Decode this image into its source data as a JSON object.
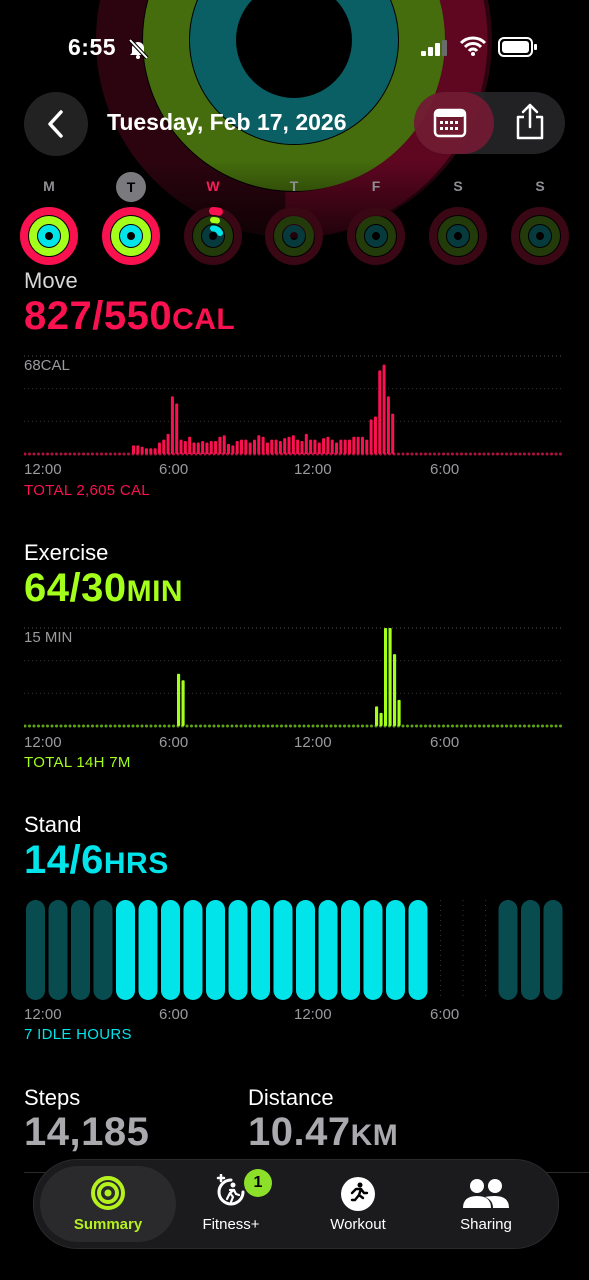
{
  "status_bar": {
    "time": "6:55"
  },
  "header": {
    "date": "Tuesday, Feb 17, 2026"
  },
  "week": {
    "days": [
      {
        "letter": "M"
      },
      {
        "letter": "T"
      },
      {
        "letter": "W"
      },
      {
        "letter": "T"
      },
      {
        "letter": "F"
      },
      {
        "letter": "S"
      },
      {
        "letter": "S"
      }
    ],
    "today_index": 1
  },
  "move": {
    "label": "Move",
    "value": "827/550",
    "unit": "CAL",
    "scale_label": "68CAL",
    "total": "TOTAL 2,605 CAL",
    "color": "#fa1150"
  },
  "exercise": {
    "label": "Exercise",
    "value": "64/30",
    "unit": "MIN",
    "scale_label": "15 MIN",
    "total": "TOTAL 14H 7M",
    "color": "#a4ff1a"
  },
  "stand": {
    "label": "Stand",
    "value": "14/6",
    "unit": "HRS",
    "total": "7 IDLE HOURS",
    "color": "#00e4ea"
  },
  "axis_ticks": [
    "12:00",
    "6:00",
    "12:00",
    "6:00"
  ],
  "steps": {
    "label": "Steps",
    "value": "14,185"
  },
  "distance": {
    "label": "Distance",
    "value": "10.47",
    "unit": "KM"
  },
  "tabs": [
    {
      "label": "Summary",
      "icon": "summary-rings-icon"
    },
    {
      "label": "Fitness+",
      "icon": "fitness-plus-icon",
      "badge": "1"
    },
    {
      "label": "Workout",
      "icon": "workout-runner-icon"
    },
    {
      "label": "Sharing",
      "icon": "sharing-people-icon"
    }
  ],
  "colors": {
    "move": "#fa1150",
    "exercise": "#a4ff1a",
    "stand": "#00e4ea",
    "accent_tab": "#b5f11f"
  },
  "chart_data": [
    {
      "type": "bar",
      "title": "Move",
      "ylabel": "CAL",
      "ylim": [
        0,
        68
      ],
      "values": [
        0,
        0,
        0,
        0,
        0,
        0,
        0,
        0,
        0,
        0,
        0,
        0,
        0,
        0,
        0,
        0,
        0,
        0,
        0,
        0,
        0,
        0,
        0,
        0,
        0,
        6,
        6,
        5,
        4,
        4,
        4,
        8,
        10,
        14,
        40,
        35,
        10,
        9,
        12,
        8,
        8,
        9,
        8,
        9,
        9,
        12,
        13,
        7,
        6,
        9,
        10,
        10,
        8,
        10,
        13,
        12,
        8,
        10,
        10,
        9,
        11,
        12,
        13,
        10,
        9,
        14,
        10,
        10,
        8,
        11,
        12,
        10,
        8,
        10,
        10,
        10,
        12,
        12,
        12,
        10,
        24,
        26,
        58,
        62,
        40,
        28,
        0,
        0,
        0,
        0,
        0,
        0,
        0,
        0,
        0,
        0,
        0,
        0,
        0,
        0,
        0,
        0,
        0,
        0,
        0,
        0,
        0,
        0,
        0,
        0,
        0,
        0,
        0,
        0,
        0,
        0,
        0,
        0,
        0,
        0,
        0,
        0,
        0,
        0,
        0
      ]
    },
    {
      "type": "bar",
      "title": "Exercise",
      "ylabel": "MIN",
      "ylim": [
        0,
        15
      ],
      "values": [
        0,
        0,
        0,
        0,
        0,
        0,
        0,
        0,
        0,
        0,
        0,
        0,
        0,
        0,
        0,
        0,
        0,
        0,
        0,
        0,
        0,
        0,
        0,
        0,
        0,
        0,
        0,
        0,
        0,
        0,
        0,
        0,
        0,
        0,
        8,
        7,
        0,
        0,
        0,
        0,
        0,
        0,
        0,
        0,
        0,
        0,
        0,
        0,
        0,
        0,
        0,
        0,
        0,
        0,
        0,
        0,
        0,
        0,
        0,
        0,
        0,
        0,
        0,
        0,
        0,
        0,
        0,
        0,
        0,
        0,
        0,
        0,
        0,
        0,
        0,
        0,
        0,
        0,
        3,
        2,
        15,
        15,
        11,
        4,
        0,
        0,
        0,
        0,
        0,
        0,
        0,
        0,
        0,
        0,
        0,
        0,
        0,
        0,
        0,
        0,
        0,
        0,
        0,
        0,
        0,
        0,
        0,
        0,
        0,
        0,
        0,
        0,
        0,
        0,
        0,
        0,
        0,
        0,
        0,
        0
      ]
    },
    {
      "type": "bar",
      "title": "Stand",
      "ylabel": "HRS",
      "values": [
        0,
        0,
        0,
        0,
        1,
        1,
        1,
        1,
        1,
        1,
        1,
        1,
        1,
        1,
        1,
        1,
        1,
        1,
        0,
        0,
        0,
        0,
        0,
        0
      ]
    }
  ]
}
